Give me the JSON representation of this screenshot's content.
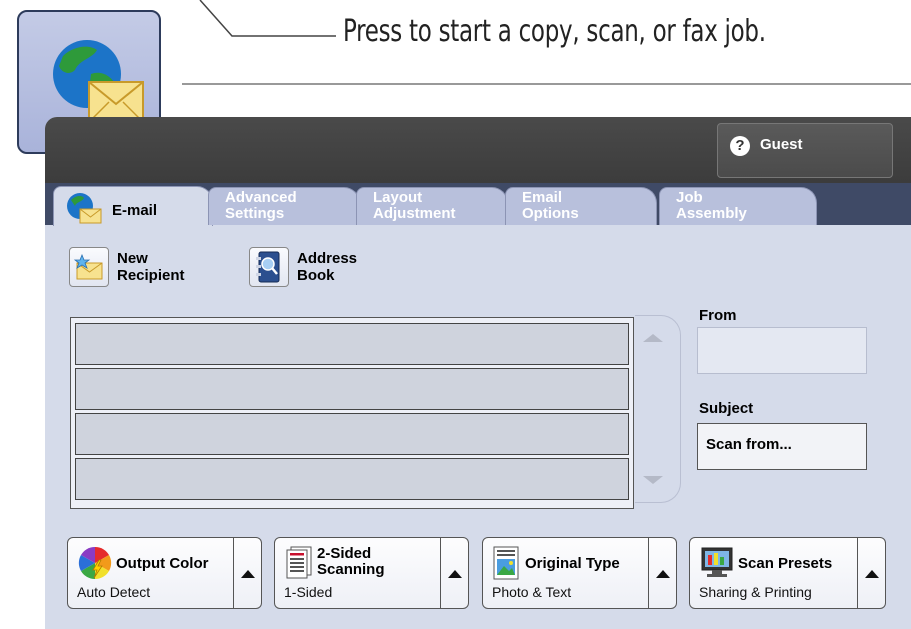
{
  "callout": {
    "text": "Press to start a copy, scan, or fax job."
  },
  "header": {
    "user_label": "Guest",
    "user_icon": "help-person-icon"
  },
  "tabs": [
    {
      "label": "E-mail",
      "active": true
    },
    {
      "label": "Advanced\nSettings",
      "active": false
    },
    {
      "label": "Layout\nAdjustment",
      "active": false
    },
    {
      "label": "Email\nOptions",
      "active": false
    },
    {
      "label": "Job\nAssembly",
      "active": false
    }
  ],
  "actions": {
    "new_recipient": "New\nRecipient",
    "address_book": "Address\nBook"
  },
  "recipients": [
    "",
    "",
    "",
    ""
  ],
  "fields": {
    "from_label": "From",
    "from_value": "",
    "subject_label": "Subject",
    "subject_value": "Scan from..."
  },
  "features": [
    {
      "title": "Output Color",
      "value": "Auto Detect",
      "icon": "color-wheel-icon"
    },
    {
      "title": "2-Sided\nScanning",
      "value": "1-Sided",
      "icon": "duplex-page-icon"
    },
    {
      "title": "Original Type",
      "value": "Photo & Text",
      "icon": "photo-document-icon"
    },
    {
      "title": "Scan Presets",
      "value": "Sharing & Printing",
      "icon": "monitor-presets-icon"
    }
  ],
  "colors": {
    "panel_bg": "#d5dbea",
    "topbar": "#444444",
    "tab_bar": "#3f4a66",
    "tab_inactive": "#b8c0dc"
  }
}
